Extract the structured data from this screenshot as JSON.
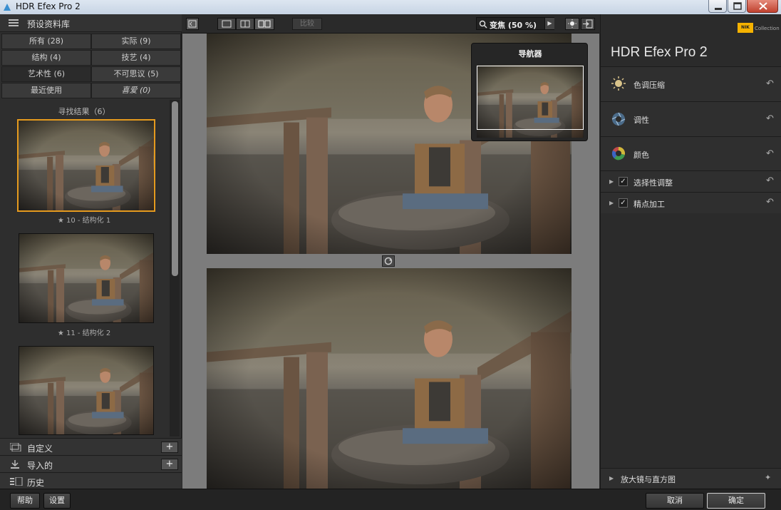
{
  "window": {
    "title": "HDR Efex Pro 2"
  },
  "library": {
    "header": "预设资料库",
    "categories": [
      {
        "label": "所有 (28)"
      },
      {
        "label": "实际 (9)"
      },
      {
        "label": "结构 (4)"
      },
      {
        "label": "技艺 (4)"
      },
      {
        "label": "艺术性 (6)"
      },
      {
        "label": "不可思议 (5)"
      },
      {
        "label": "最近使用"
      },
      {
        "label": "喜爱 (0)"
      }
    ],
    "results_title": "寻找结果（6）",
    "presets": [
      {
        "caption": "★ 10 - 结构化 1"
      },
      {
        "caption": "★ 11 - 结构化 2"
      }
    ],
    "custom": "自定义",
    "imported": "导入的",
    "history": "历史"
  },
  "toolbar": {
    "compare_label": "比较",
    "zoom_label": "变焦 (50 %)"
  },
  "navigator": {
    "title": "导航器"
  },
  "right": {
    "brand_badge": "NIK",
    "brand_collection": "Collection",
    "app_title_main": "HDR Efex Pro",
    "app_title_version": "2",
    "filters": [
      {
        "label": "色调压缩"
      },
      {
        "label": "调性"
      },
      {
        "label": "颜色"
      }
    ],
    "subs": [
      {
        "label": "选择性调整",
        "checked": "✓"
      },
      {
        "label": "精点加工",
        "checked": "✓"
      }
    ],
    "loupe": "放大镜与直方图"
  },
  "bottom": {
    "help": "帮助",
    "settings": "设置",
    "cancel": "取消",
    "ok": "确定"
  },
  "colors": {
    "accent": "#e59a1e",
    "panel": "#2e2e2e",
    "canvas": "#7c7c7c"
  },
  "icons": [
    "app-logo-icon",
    "list-icon",
    "minimize-icon",
    "maximize-icon",
    "close-icon",
    "magnifier-icon",
    "light-icon",
    "exit-icon",
    "sun-icon",
    "aperture-icon",
    "color-wheel-icon",
    "reset-icon",
    "pin-icon",
    "plus-icon",
    "swap-icon"
  ]
}
